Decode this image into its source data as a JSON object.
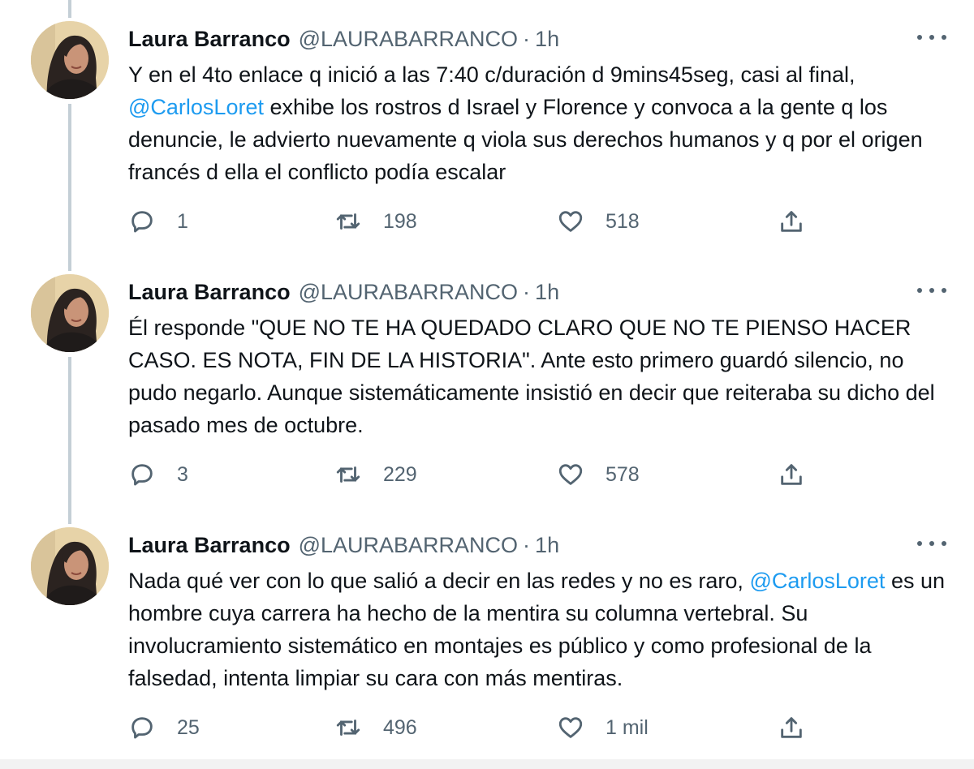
{
  "colors": {
    "mention": "#1d9bf0",
    "secondary_text": "#536471",
    "thread_line": "#c4cfd6"
  },
  "tweets": [
    {
      "author_name": "Laura Barranco",
      "handle": "@LAURABARRANCO",
      "separator": "·",
      "time": "1h",
      "text_segments": [
        {
          "text": "Y en el 4to enlace q inició a las 7:40 c/duración d 9mins45seg, casi al final, ",
          "mention": false
        },
        {
          "text": "@CarlosLoret",
          "mention": true
        },
        {
          "text": " exhibe los rostros d Israel y Florence y convoca a la gente q los denuncie, le advierto nuevamente q viola sus derechos humanos y q por el origen francés d ella el conflicto podía escalar",
          "mention": false
        }
      ],
      "replies": "1",
      "retweets": "198",
      "likes": "518",
      "icons": {
        "reply": "reply-icon",
        "retweet": "retweet-icon",
        "like": "heart-icon",
        "share": "share-icon",
        "more": "more-icon"
      }
    },
    {
      "author_name": "Laura Barranco",
      "handle": "@LAURABARRANCO",
      "separator": "·",
      "time": "1h",
      "text_segments": [
        {
          "text": "Él responde \"QUE NO TE HA QUEDADO CLARO QUE NO TE PIENSO HACER CASO. ES NOTA, FIN DE LA HISTORIA\". Ante esto primero guardó silencio, no pudo negarlo. Aunque sistemáticamente insistió en decir que reiteraba su dicho del pasado mes de octubre.",
          "mention": false
        }
      ],
      "replies": "3",
      "retweets": "229",
      "likes": "578",
      "icons": {
        "reply": "reply-icon",
        "retweet": "retweet-icon",
        "like": "heart-icon",
        "share": "share-icon",
        "more": "more-icon"
      }
    },
    {
      "author_name": "Laura Barranco",
      "handle": "@LAURABARRANCO",
      "separator": "·",
      "time": "1h",
      "text_segments": [
        {
          "text": "Nada qué ver con lo que salió a decir en las redes y no es raro, ",
          "mention": false
        },
        {
          "text": "@CarlosLoret",
          "mention": true
        },
        {
          "text": " es un hombre cuya carrera ha hecho de la mentira su columna vertebral. Su involucramiento sistemático en montajes es público y como profesional de la falsedad, intenta limpiar su cara con más mentiras.",
          "mention": false
        }
      ],
      "replies": "25",
      "retweets": "496",
      "likes": "1 mil",
      "icons": {
        "reply": "reply-icon",
        "retweet": "retweet-icon",
        "like": "heart-icon",
        "share": "share-icon",
        "more": "more-icon"
      }
    }
  ]
}
